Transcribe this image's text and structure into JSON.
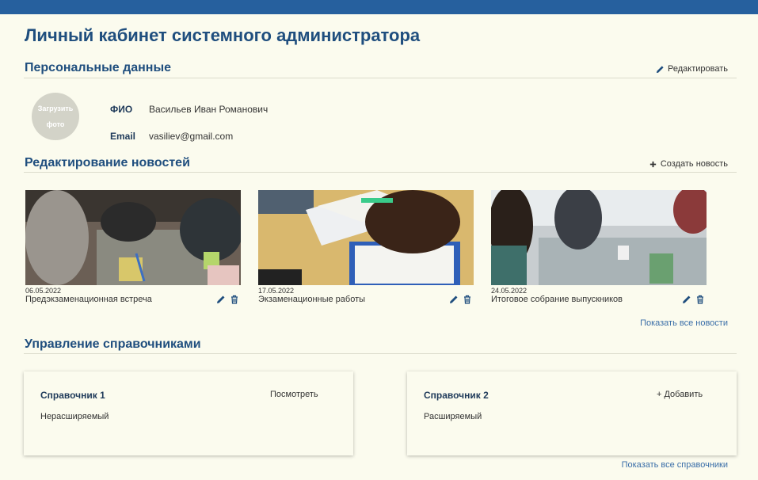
{
  "header": {
    "title": "Личный кабинет системного администратора",
    "accent": "#26609e"
  },
  "personal": {
    "section_title": "Персональные данные",
    "edit_label": "Редактировать",
    "avatar_label": "Загрузить фото",
    "fio_label": "ФИО",
    "fio_value": "Васильев Иван Романович",
    "email_label": "Email",
    "email_value": "vasiliev@gmail.com"
  },
  "news": {
    "section_title": "Редактирование новостей",
    "create_label": "Создать новость",
    "show_all_label": "Показать все новости",
    "items": [
      {
        "date": "06.05.2022",
        "title": "Предэкзаменационная встреча",
        "image": "students-meeting-photo"
      },
      {
        "date": "17.05.2022",
        "title": "Экзаменационные работы",
        "image": "exam-writing-photo"
      },
      {
        "date": "24.05.2022",
        "title": "Итоговое собрание выпускников",
        "image": "graduates-meeting-photo"
      }
    ]
  },
  "references": {
    "section_title": "Управление справочниками",
    "show_all_label": "Показать все справочники",
    "items": [
      {
        "name": "Справочник 1",
        "type": "Нерасширяемый",
        "action": "Посмотреть"
      },
      {
        "name": "Справочник 2",
        "type": "Расширяемый",
        "action": "+ Добавить"
      }
    ]
  }
}
